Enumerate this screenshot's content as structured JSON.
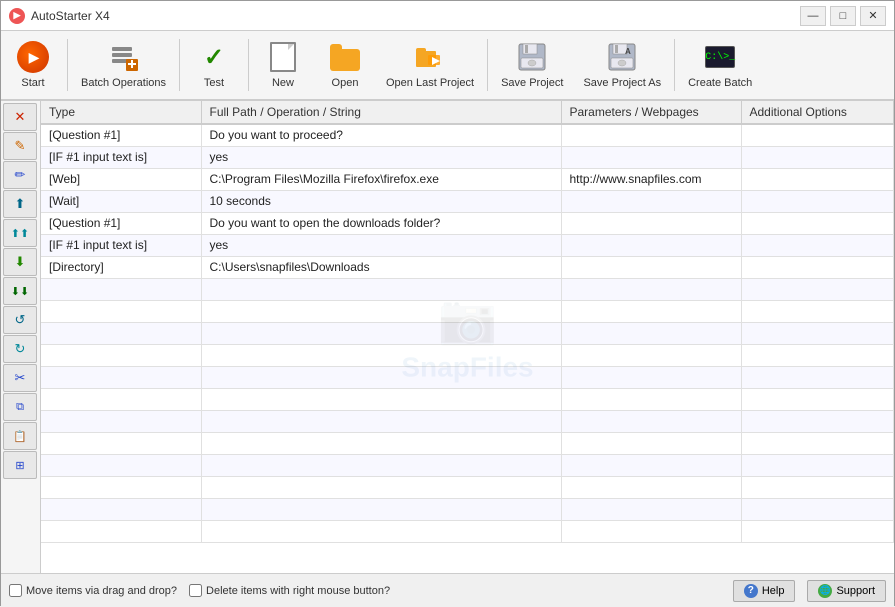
{
  "titlebar": {
    "title": "AutoStarter X4",
    "minimize": "—",
    "maximize": "□",
    "close": "✕"
  },
  "toolbar": {
    "buttons": [
      {
        "id": "start",
        "label": "Start",
        "icon": "start-icon"
      },
      {
        "id": "batch-operations",
        "label": "Batch Operations",
        "icon": "batch-icon"
      },
      {
        "id": "test",
        "label": "Test",
        "icon": "test-icon"
      },
      {
        "id": "new",
        "label": "New",
        "icon": "new-icon"
      },
      {
        "id": "open",
        "label": "Open",
        "icon": "open-icon"
      },
      {
        "id": "open-last",
        "label": "Open Last Project",
        "icon": "open-last-icon"
      },
      {
        "id": "save",
        "label": "Save Project",
        "icon": "save-icon"
      },
      {
        "id": "save-as",
        "label": "Save Project As",
        "icon": "save-as-icon"
      },
      {
        "id": "create-batch",
        "label": "Create Batch",
        "icon": "create-batch-icon"
      }
    ]
  },
  "table": {
    "columns": [
      "Type",
      "Full Path / Operation / String",
      "Parameters / Webpages",
      "Additional Options"
    ],
    "rows": [
      {
        "type": "[Question #1]",
        "operation": "Do you want to proceed?",
        "params": "",
        "options": ""
      },
      {
        "type": "[IF #1 input text is]",
        "operation": "yes",
        "params": "",
        "options": ""
      },
      {
        "type": "[Web]",
        "operation": "C:\\Program Files\\Mozilla Firefox\\firefox.exe",
        "params": "http://www.snapfiles.com",
        "options": ""
      },
      {
        "type": "[Wait]",
        "operation": "10 seconds",
        "params": "",
        "options": ""
      },
      {
        "type": "[Question #1]",
        "operation": "Do you want to open the downloads folder?",
        "params": "",
        "options": ""
      },
      {
        "type": "[IF #1 input text is]",
        "operation": "yes",
        "params": "",
        "options": ""
      },
      {
        "type": "[Directory]",
        "operation": "C:\\Users\\snapfiles\\Downloads",
        "params": "",
        "options": ""
      }
    ],
    "emptyRows": 12
  },
  "sidebar": {
    "buttons": [
      {
        "id": "delete",
        "symbol": "✕",
        "color": "red",
        "title": "Delete item"
      },
      {
        "id": "edit",
        "symbol": "✎",
        "color": "orange",
        "title": "Edit item"
      },
      {
        "id": "pencil2",
        "symbol": "✏",
        "color": "blue",
        "title": "Add item"
      },
      {
        "id": "up1",
        "symbol": "⬆",
        "color": "teal",
        "title": "Move up"
      },
      {
        "id": "up2",
        "symbol": "↑",
        "color": "teal2",
        "title": "Move to top"
      },
      {
        "id": "down1",
        "symbol": "⬇",
        "color": "green",
        "title": "Move down"
      },
      {
        "id": "down2",
        "symbol": "↓",
        "color": "darkgreen",
        "title": "Move to bottom"
      },
      {
        "id": "undo",
        "symbol": "↺",
        "color": "teal",
        "title": "Undo"
      },
      {
        "id": "redo",
        "symbol": "↻",
        "color": "teal2",
        "title": "Redo"
      },
      {
        "id": "cut",
        "symbol": "✂",
        "color": "blue",
        "title": "Cut"
      },
      {
        "id": "copy",
        "symbol": "❑",
        "color": "blue",
        "title": "Copy"
      },
      {
        "id": "paste",
        "symbol": "❒",
        "color": "blue",
        "title": "Paste"
      },
      {
        "id": "multipage",
        "symbol": "⊞",
        "color": "blue",
        "title": "Multi"
      }
    ]
  },
  "statusbar": {
    "checkbox1_label": "Move items via drag and drop?",
    "checkbox2_label": "Delete items with right mouse button?",
    "help_label": "Help",
    "support_label": "Support"
  },
  "watermark": {
    "text": "SnapFiles"
  }
}
